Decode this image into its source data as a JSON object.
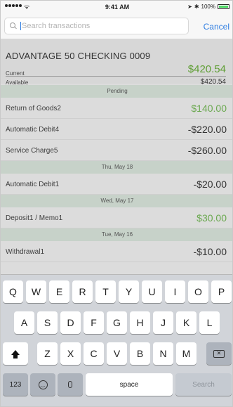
{
  "status_bar": {
    "time": "9:41 AM",
    "battery": "100%"
  },
  "search": {
    "placeholder": "Search transactions",
    "cancel_label": "Cancel"
  },
  "account": {
    "name": "ADVANTAGE 50 CHECKING 0009",
    "current_label": "Current",
    "current_value": "$420.54",
    "available_label": "Available",
    "available_value": "$420.54"
  },
  "transactions": {
    "sections": [
      {
        "header": "Pending",
        "items": [
          {
            "name": "Return of Goods2",
            "amount": "$140.00"
          },
          {
            "name": "Automatic Debit4",
            "amount": "-$220.00"
          },
          {
            "name": "Service Charge5",
            "amount": "-$260.00"
          }
        ]
      },
      {
        "header": "Thu, May 18",
        "items": [
          {
            "name": "Automatic Debit1",
            "amount": "-$20.00"
          }
        ]
      },
      {
        "header": "Wed, May 17",
        "items": [
          {
            "name": "Deposit1 / Memo1",
            "amount": "$30.00"
          }
        ]
      },
      {
        "header": "Tue, May 16",
        "items": [
          {
            "name": "Withdrawal1",
            "amount": "-$10.00"
          }
        ]
      }
    ]
  },
  "colors": {
    "accent": "#2f7de1",
    "positive": "#6aa84f",
    "section_bg": "#c7d2c9"
  },
  "keyboard": {
    "row1": [
      "Q",
      "W",
      "E",
      "R",
      "T",
      "Y",
      "U",
      "I",
      "O",
      "P"
    ],
    "row2": [
      "A",
      "S",
      "D",
      "F",
      "G",
      "H",
      "J",
      "K",
      "L"
    ],
    "row3": [
      "Z",
      "X",
      "C",
      "V",
      "B",
      "N",
      "M"
    ],
    "numbers_label": "123",
    "space_label": "space",
    "search_label": "Search",
    "shift_icon": "shift-icon",
    "delete_icon": "delete-icon",
    "emoji_icon": "emoji-icon",
    "mic_icon": "microphone-icon"
  }
}
